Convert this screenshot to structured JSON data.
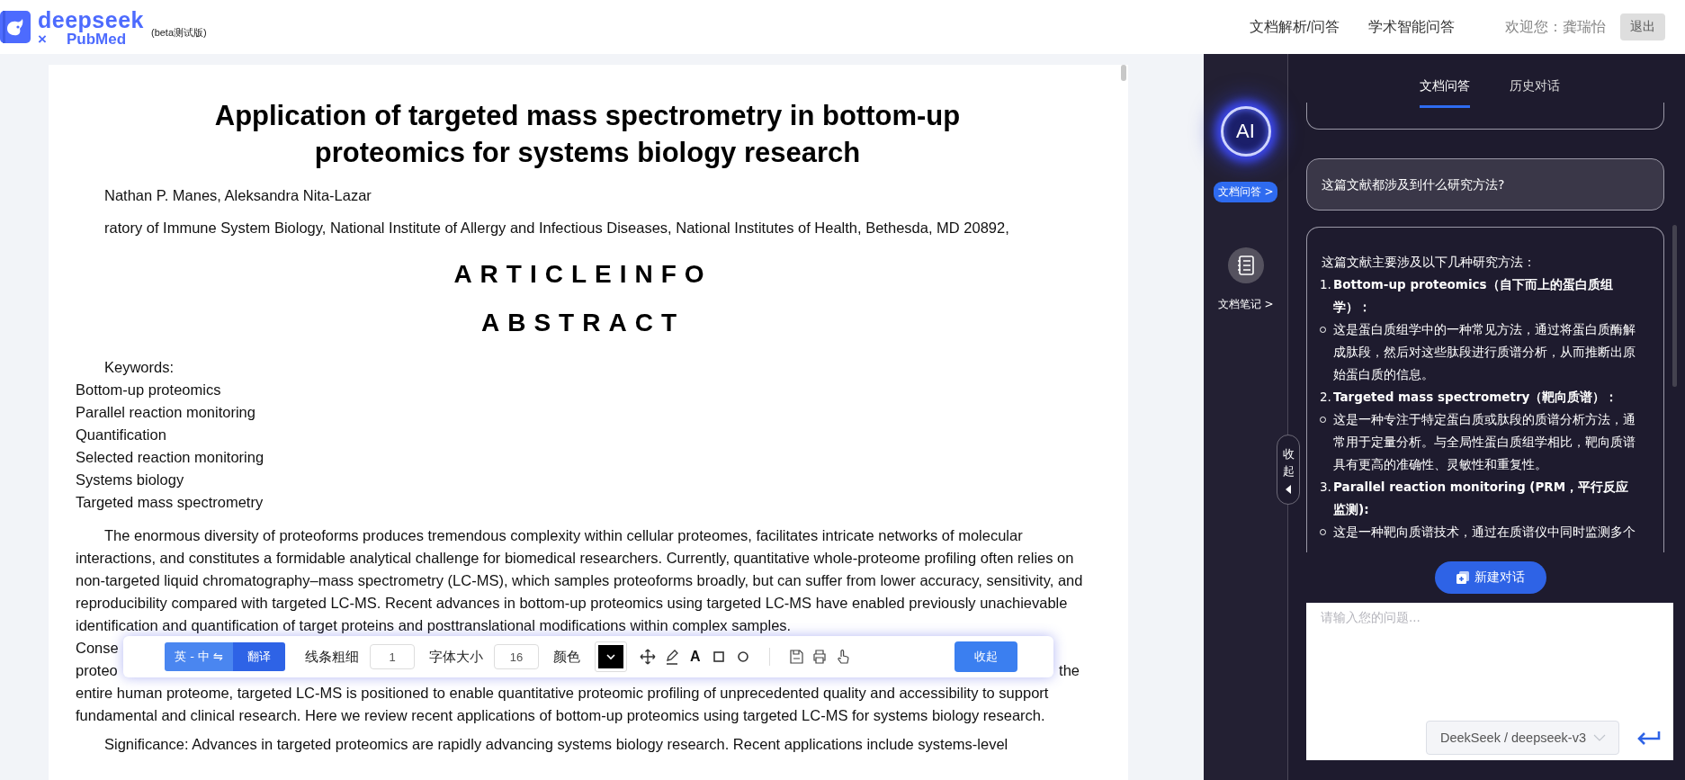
{
  "header": {
    "logo": {
      "name": "deepseek",
      "cross": "×",
      "partner": "PubMed",
      "badge": "(beta测试版)"
    },
    "nav": [
      {
        "label": "文档解析/问答"
      },
      {
        "label": "学术智能问答"
      }
    ],
    "greeting": "欢迎您：龚瑞怡",
    "logout": "退出"
  },
  "document": {
    "title": "Application of targeted mass spectrometry in bottom-up proteomics for systems biology research",
    "authors": "Nathan P. Manes, Aleksandra Nita-Lazar",
    "affiliation": "ratory of Immune System Biology, National Institute of Allergy and Infectious Diseases, National Institutes of Health, Bethesda, MD 20892,",
    "section_headings": [
      "ARTICLEINFO",
      "ABSTRACT"
    ],
    "keywords_label": "Keywords:",
    "keywords": [
      "Bottom-up proteomics",
      "Parallel reaction monitoring",
      "Quantification",
      "Selected reaction monitoring",
      "Systems biology",
      "Targeted mass spectrometry"
    ],
    "abstract": {
      "text_start": "The enormous diversity of proteoforms produces tremendous complexity within cellular proteomes, facilitates intricate networks of molecular interactions, and constitutes a formidable analytical challenge for biomedical researchers. Currently, quantitative whole-proteome profiling often relies on non-targeted liquid chromatography–mass spectrometry (LC-MS), which samples proteoforms broadly, but can suffer from lower accuracy, sensitivity, and reproducibility compared with targeted LC-MS. Recent advances in bottom-up proteomics using targeted LC-MS have enabled previously unachievable identification and quantification of target proteins and posttranslational modifications within complex samples.",
      "covered_lines": [
        {
          "left": "Conse"
        },
        {
          "left": "proteo",
          "right": "the"
        }
      ],
      "text_end": "entire human proteome, targeted LC-MS is positioned to enable quantitative proteomic profiling of unprecedented quality and accessibility to support fundamental and clinical research. Here we review recent applications of bottom-up proteomics using targeted LC-MS for systems biology research."
    },
    "significance": "Significance: Advances in targeted proteomics are rapidly advancing systems biology research. Recent applications include systems-level"
  },
  "toolbar": {
    "language": "英 - 中 ⇋",
    "translate": "翻译",
    "line_width": {
      "label": "线条粗细",
      "value": "1"
    },
    "font_size": {
      "label": "字体大小",
      "value": "16"
    },
    "color": {
      "label": "颜色",
      "color": "#000000"
    },
    "tools": [
      {
        "kind": "move"
      },
      {
        "kind": "pen"
      },
      {
        "kind": "text",
        "glyph": "A"
      },
      {
        "kind": "rect"
      },
      {
        "kind": "circle"
      }
    ],
    "actions": [
      {
        "kind": "save"
      },
      {
        "kind": "print"
      },
      {
        "kind": "hand"
      }
    ],
    "collapse": "收起"
  },
  "assistant_panel": {
    "sidebar": {
      "items": [
        {
          "kind": "ai",
          "badge": "AI",
          "label": "文档问答 >",
          "selected": true
        },
        {
          "kind": "notes",
          "label": "文档笔记 >",
          "selected": false
        }
      ]
    },
    "collapse_handle": "收起",
    "tabs": [
      {
        "label": "文档问答",
        "selected": true
      },
      {
        "label": "历史对话",
        "selected": false
      }
    ],
    "messages": [
      {
        "kind": "user",
        "text": "这篇文献都涉及到什么研究方法?"
      },
      {
        "kind": "assistant",
        "intro": "这篇文献主要涉及以下几种研究方法：",
        "items": [
          {
            "number": "1.",
            "title": "Bottom-up proteomics（自下而上的蛋白质组学）：",
            "bullets": [
              "这是蛋白质组学中的一种常见方法，通过将蛋白质酶解成肽段，然后对这些肽段进行质谱分析，从而推断出原始蛋白质的信息。"
            ]
          },
          {
            "number": "2.",
            "title": "Targeted mass spectrometry（靶向质谱）：",
            "bullets": [
              "这是一种专注于特定蛋白质或肽段的质谱分析方法，通常用于定量分析。与全局性蛋白质组学相比，靶向质谱具有更高的准确性、灵敏性和重复性。"
            ]
          },
          {
            "number": "3.",
            "title": "Parallel reaction monitoring (PRM，平行反应监测):",
            "bullets": [
              "这是一种靶向质谱技术，通过在质谱仪中同时监测多个"
            ]
          }
        ]
      }
    ],
    "new_chat": "新建对话",
    "input": {
      "placeholder": "请输入您的问题..."
    },
    "model_select": {
      "value": "DeekSeek / deepseek-v3"
    }
  }
}
